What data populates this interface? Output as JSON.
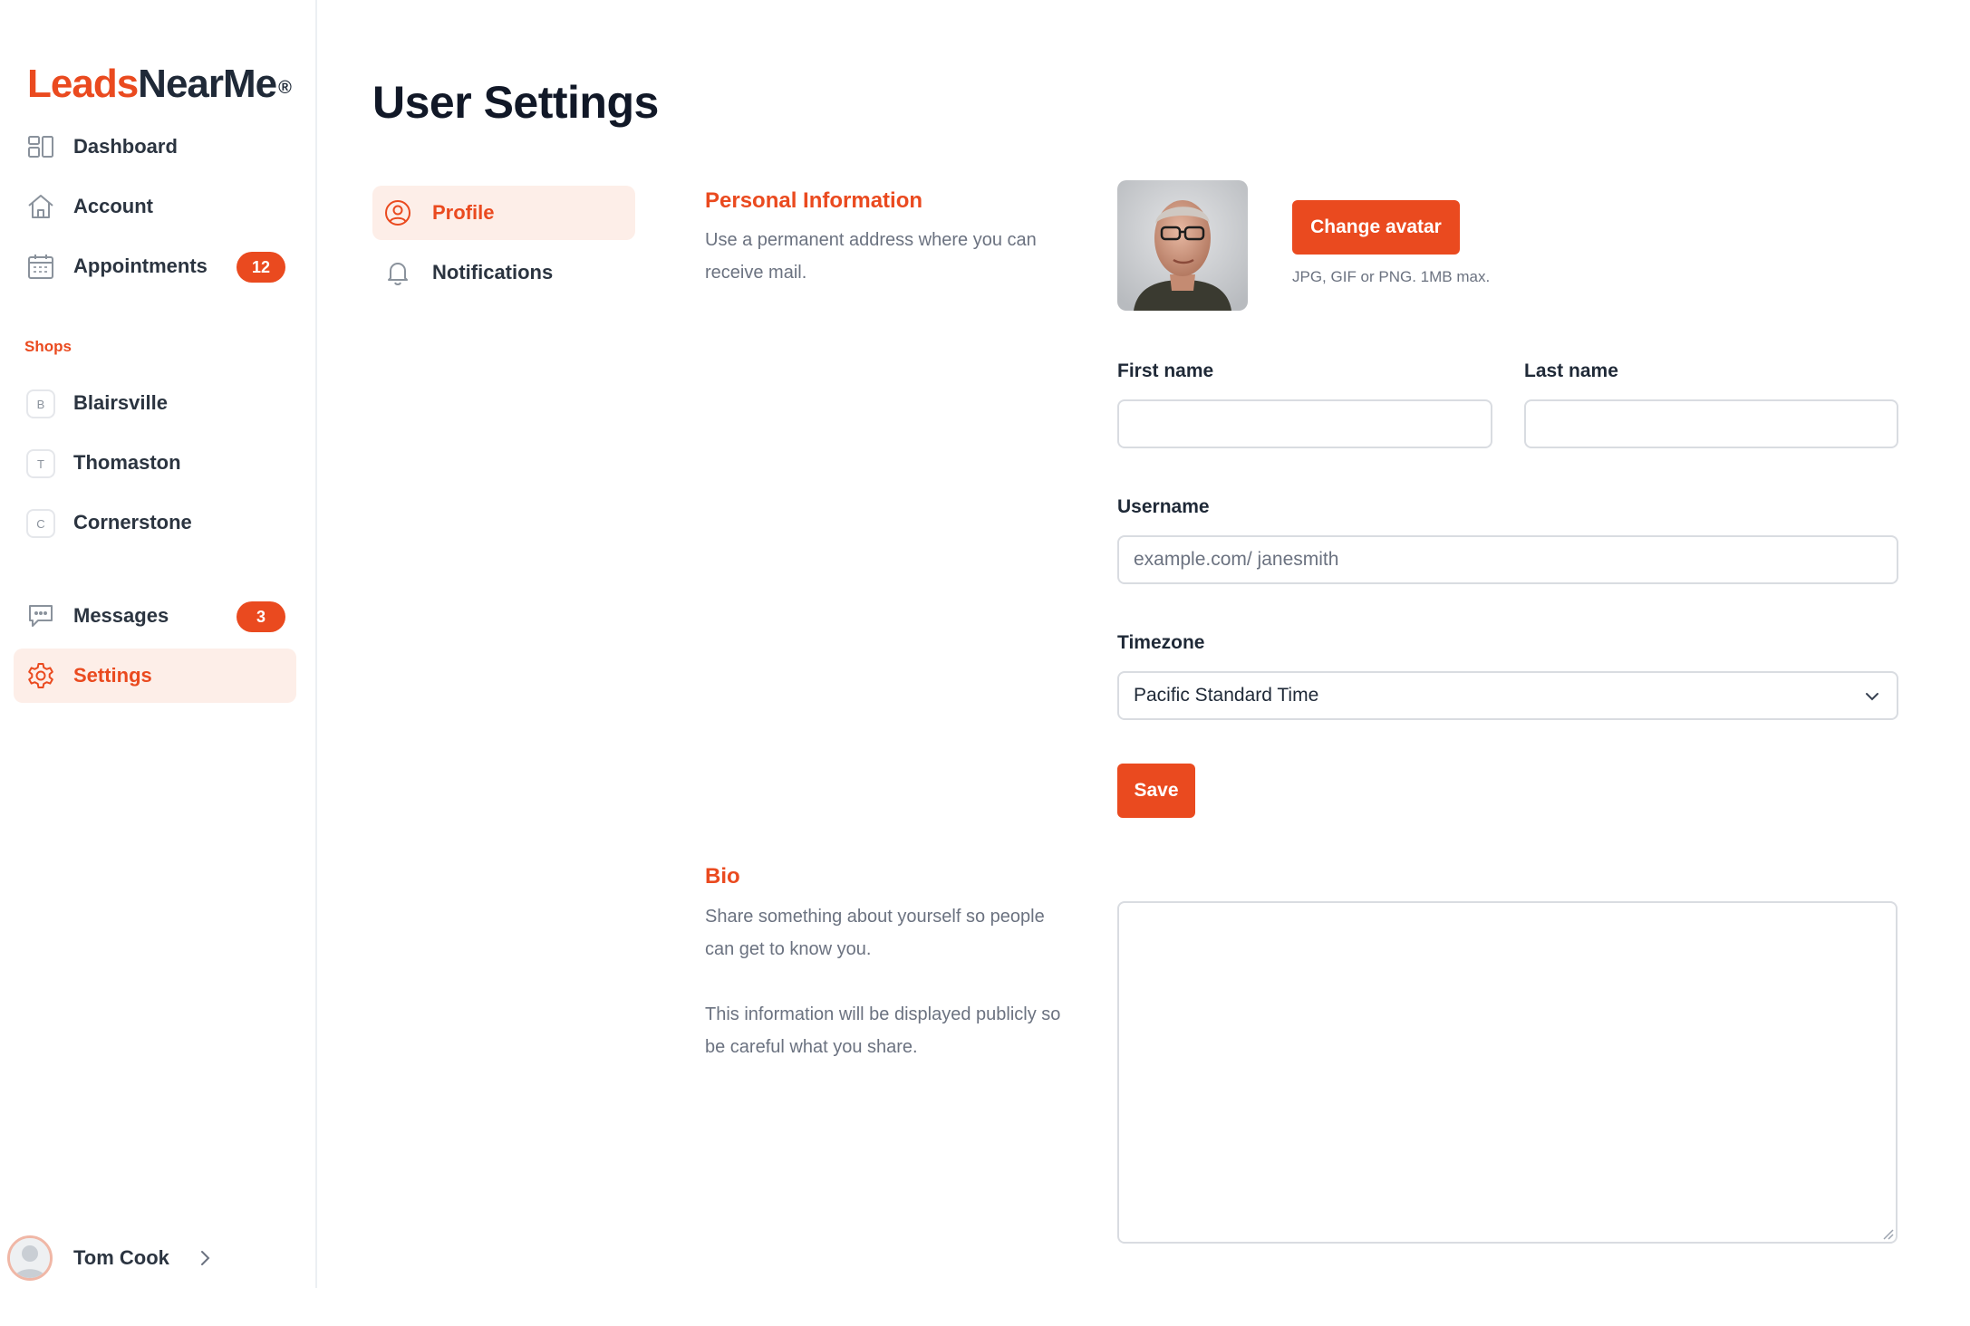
{
  "brand": {
    "name_part1": "Leads",
    "name_part2": "NearMe",
    "registered": "®",
    "accent_color": "#ea4a1f"
  },
  "sidebar": {
    "nav": [
      {
        "label": "Dashboard",
        "icon": "dashboard-icon"
      },
      {
        "label": "Account",
        "icon": "home-icon"
      },
      {
        "label": "Appointments",
        "icon": "calendar-icon",
        "badge": "12"
      }
    ],
    "shops_heading": "Shops",
    "shops": [
      {
        "initial": "B",
        "label": "Blairsville"
      },
      {
        "initial": "T",
        "label": "Thomaston"
      },
      {
        "initial": "C",
        "label": "Cornerstone"
      }
    ],
    "bottom_nav": [
      {
        "label": "Messages",
        "icon": "chat-icon",
        "badge": "3"
      },
      {
        "label": "Settings",
        "icon": "gear-icon",
        "active": true
      }
    ],
    "user": {
      "name": "Tom Cook"
    }
  },
  "main": {
    "title": "User Settings",
    "subnav": [
      {
        "label": "Profile",
        "icon": "user-circle-icon",
        "active": true
      },
      {
        "label": "Notifications",
        "icon": "bell-icon"
      }
    ],
    "personal": {
      "title": "Personal Information",
      "description": "Use a permanent address where you can receive mail."
    },
    "avatar": {
      "change_label": "Change avatar",
      "hint": "JPG, GIF or PNG. 1MB max."
    },
    "form": {
      "first_name_label": "First name",
      "first_name_value": "",
      "last_name_label": "Last name",
      "last_name_value": "",
      "username_label": "Username",
      "username_value": "example.com/ janesmith",
      "timezone_label": "Timezone",
      "timezone_value": "Pacific Standard Time",
      "save_label": "Save"
    },
    "bio": {
      "title": "Bio",
      "description_1": "Share something about yourself so people can get to know you.",
      "description_2": "This information will be displayed publicly so be careful what you share.",
      "value": ""
    }
  }
}
